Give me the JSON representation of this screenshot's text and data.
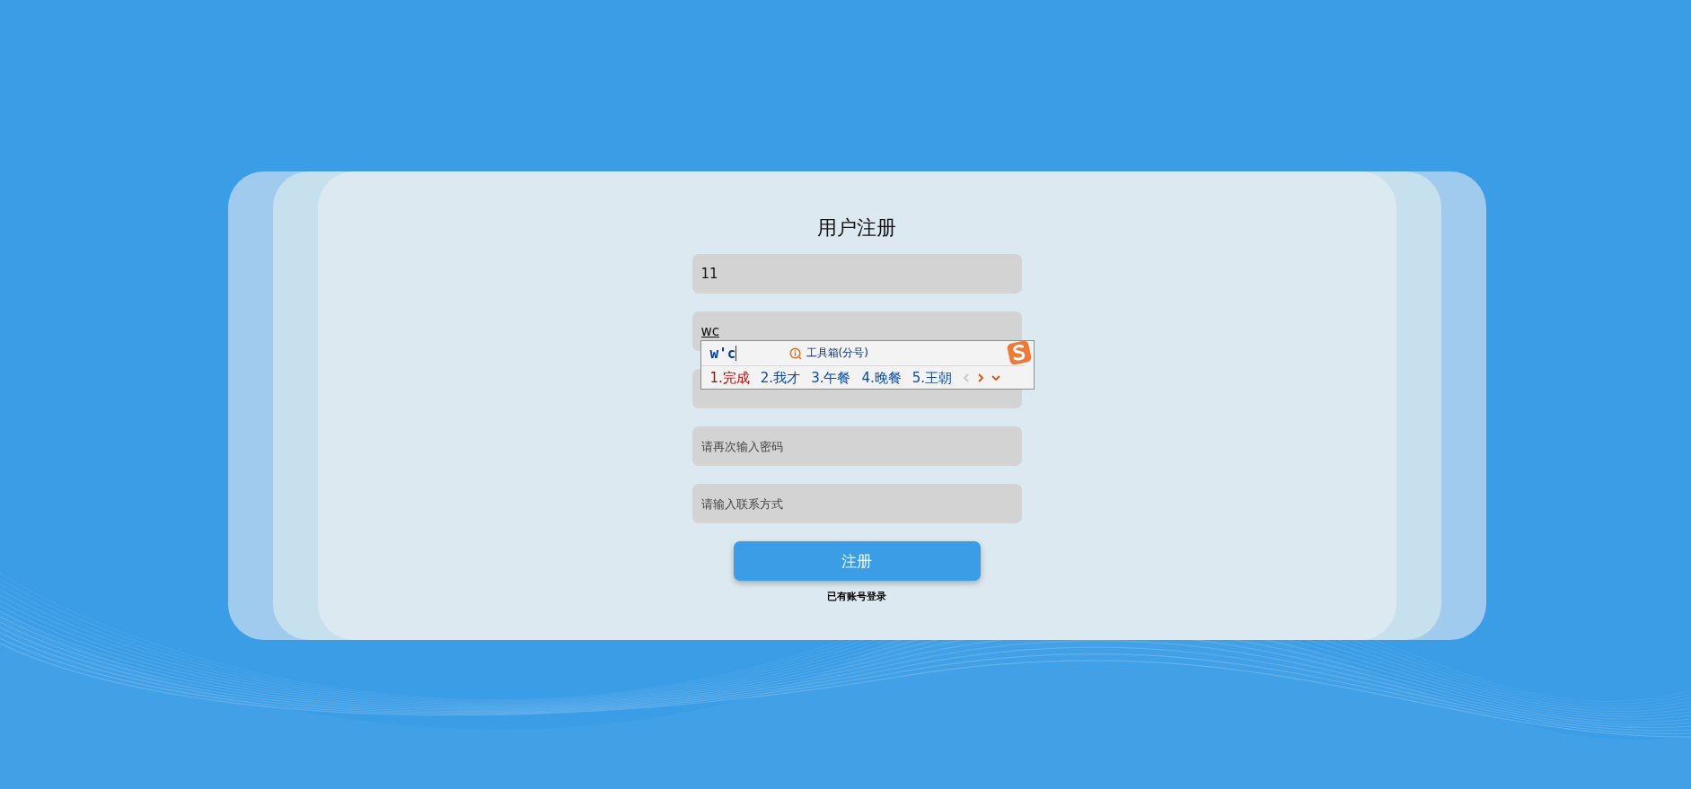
{
  "title": "用户注册",
  "fields": [
    {
      "value": "11",
      "composing": false
    },
    {
      "value": "wc",
      "composing": true
    },
    {
      "placeholder": "请再次输入密码"
    },
    {
      "placeholder": "请输入联系方式"
    }
  ],
  "ime": {
    "composition": "w'c",
    "toolbox": "工具箱(分号)",
    "prev_disabled": true,
    "next_disabled": false,
    "candidates": [
      {
        "label": "1.完成",
        "selected": true
      },
      {
        "label": "2.我才",
        "selected": false
      },
      {
        "label": "3.午餐",
        "selected": false
      },
      {
        "label": "4.晚餐",
        "selected": false
      },
      {
        "label": "5.王朝",
        "selected": false
      }
    ]
  },
  "submit": "注册",
  "login_link": "已有账号登录"
}
